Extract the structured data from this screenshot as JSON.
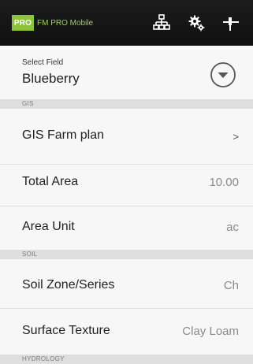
{
  "app": {
    "logo_text": "PRO",
    "title": "FM PRO Mobile",
    "accent_color": "#8cc33a",
    "actions": [
      {
        "icon": "sitemap-icon",
        "label": ""
      },
      {
        "icon": "settings-gears-icon",
        "label": ""
      },
      {
        "icon": "pin-icon",
        "label": ""
      }
    ]
  },
  "select_field": {
    "label": "Select Field",
    "value": "Blueberry",
    "dropdown_icon": "chevron-down-circle-icon"
  },
  "sections": {
    "gis": "GIS",
    "soil": "SOIL",
    "hydrology": "HYDROLOGY"
  },
  "rows": {
    "gis_farm_plan": {
      "label": "GIS Farm plan",
      "chevron": ">"
    },
    "total_area": {
      "label": "Total Area",
      "value": "10.00"
    },
    "area_unit": {
      "label": "Area Unit",
      "value": "ac"
    },
    "soil_zone": {
      "label": "Soil Zone/Series",
      "value": "Ch"
    },
    "surface_texture": {
      "label": "Surface Texture",
      "value": "Clay Loam"
    }
  }
}
